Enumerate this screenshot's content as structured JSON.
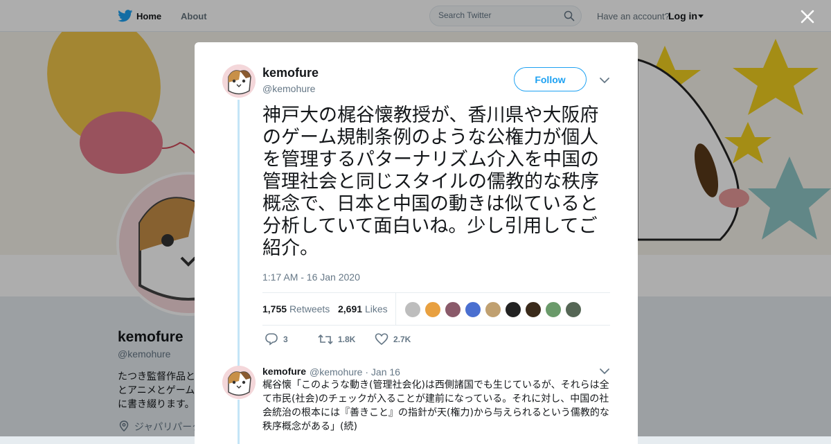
{
  "nav": {
    "home_label": "Home",
    "about_label": "About",
    "search_placeholder": "Search Twitter",
    "have_account": "Have an account?",
    "login_label": "Log in"
  },
  "background_profile": {
    "name": "kemofure",
    "handle": "@kemohure",
    "bio": "たつき監督作品と\nとアニメとゲーム\nに書き綴ります。",
    "location": "ジャパリパーク"
  },
  "tweet": {
    "author_name": "kemofure",
    "author_handle": "@kemohure",
    "follow_label": "Follow",
    "text": "神戸大の梶谷懐教授が、香川県や大阪府のゲーム規制条例のような公権力が個人を管理するパターナリズム介入を中国の管理社会と同じスタイルの儒教的な秩序概念で、日本と中国の動きは似ていると分析していて面白いね。少し引用してご紹介。",
    "timestamp": "1:17 AM - 16 Jan 2020",
    "retweets_count": "1,755",
    "retweets_label": "Retweets",
    "likes_count": "2,691",
    "likes_label": "Likes",
    "reply_count": "3",
    "retweet_count_short": "1.8K",
    "like_count_short": "2.7K"
  },
  "reply": {
    "author_name": "kemofure",
    "author_handle": "@kemohure · Jan 16",
    "text": "梶谷懐「このような動き(管理社会化)は西側諸国でも生じているが、それらは全て市民(社会)のチェックが入ることが建前になっている。それに対し、中国の社会統治の根本には『善きこと』の指針が天(権力)から与えられるという儒教的な秩序概念がある」(続)"
  },
  "colors": {
    "brand": "#1da1f2",
    "text": "#14171a",
    "secondary": "#657786",
    "thread_line": "#c4e5f7"
  },
  "likers": [
    "#bdbdbd",
    "#e8a040",
    "#8a5a6a",
    "#4a6fd0",
    "#c0a070",
    "#222222",
    "#3a2a1a",
    "#6a9a6a",
    "#556655"
  ]
}
